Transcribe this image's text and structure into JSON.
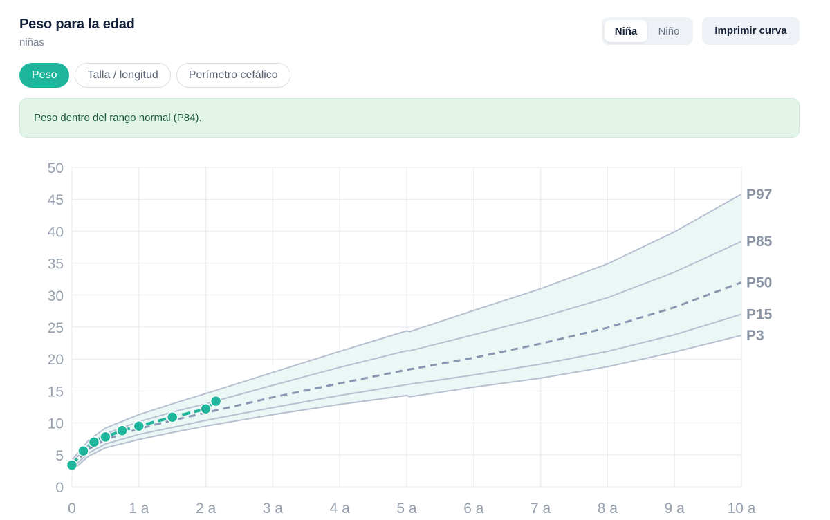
{
  "header": {
    "title": "Peso para la edad",
    "subtitle": "niñas",
    "sex_options": [
      "Niña",
      "Niño"
    ],
    "sex_selected": "Niña",
    "print_label": "Imprimir curva"
  },
  "tabs": [
    {
      "label": "Peso",
      "active": true
    },
    {
      "label": "Talla / longitud",
      "active": false
    },
    {
      "label": "Perímetro cefálico",
      "active": false
    }
  ],
  "status": {
    "message": "Peso dentro del rango normal (P84).",
    "color": "#e3f5e8"
  },
  "colors": {
    "accent": "#1db59b",
    "curve": "#b7c0d0",
    "median": "#8a97b3",
    "band": "#eaf7f5"
  },
  "chart_data": {
    "type": "line",
    "title": "",
    "xlabel": "",
    "ylabel": "",
    "xlim": [
      0,
      10
    ],
    "ylim": [
      0,
      50
    ],
    "x_ticks": [
      0,
      1,
      2,
      3,
      4,
      5,
      6,
      7,
      8,
      9,
      10
    ],
    "x_tick_labels": [
      "0",
      "1 a",
      "2 a",
      "3 a",
      "4 a",
      "5 a",
      "6 a",
      "7 a",
      "8 a",
      "9 a",
      "10 a"
    ],
    "y_ticks": [
      0,
      5,
      10,
      15,
      20,
      25,
      30,
      35,
      40,
      45,
      50
    ],
    "y_tick_labels": [
      "0",
      "5",
      "10",
      "15",
      "20",
      "25",
      "30",
      "35",
      "40",
      "45",
      "50"
    ],
    "grid": true,
    "shaded_band": [
      "P3",
      "P97"
    ],
    "series": [
      {
        "name": "P97",
        "style": "solid",
        "x": [
          0,
          0.25,
          0.5,
          1,
          1.5,
          2,
          3,
          4,
          5,
          5.05,
          6,
          7,
          8,
          9,
          10
        ],
        "y": [
          4.2,
          7.3,
          9.2,
          11.3,
          13.0,
          14.6,
          17.9,
          21.2,
          24.4,
          24.3,
          27.6,
          31.0,
          34.9,
          39.9,
          45.8
        ]
      },
      {
        "name": "P85",
        "style": "solid",
        "x": [
          0,
          0.25,
          0.5,
          1,
          1.5,
          2,
          3,
          4,
          5,
          5.05,
          6,
          7,
          8,
          9,
          10
        ],
        "y": [
          3.8,
          6.6,
          8.3,
          10.2,
          11.7,
          13.0,
          15.9,
          18.7,
          21.3,
          21.3,
          23.8,
          26.5,
          29.6,
          33.6,
          38.4
        ]
      },
      {
        "name": "P50",
        "style": "dashed",
        "x": [
          0,
          0.25,
          0.5,
          1,
          1.5,
          2,
          3,
          4,
          5,
          6,
          7,
          8,
          9,
          10
        ],
        "y": [
          3.3,
          5.9,
          7.4,
          9.1,
          10.4,
          11.6,
          14.0,
          16.2,
          18.3,
          20.2,
          22.4,
          24.9,
          28.1,
          32.0
        ]
      },
      {
        "name": "P15",
        "style": "solid",
        "x": [
          0,
          0.25,
          0.5,
          1,
          1.5,
          2,
          3,
          4,
          5,
          6,
          7,
          8,
          9,
          10
        ],
        "y": [
          2.9,
          5.3,
          6.7,
          8.2,
          9.3,
          10.4,
          12.4,
          14.3,
          16.0,
          17.5,
          19.2,
          21.2,
          23.8,
          27.0
        ]
      },
      {
        "name": "P3",
        "style": "solid",
        "x": [
          0,
          0.25,
          0.5,
          1,
          1.5,
          2,
          3,
          4,
          5,
          5.05,
          6,
          7,
          8,
          9,
          10
        ],
        "y": [
          2.5,
          4.8,
          6.1,
          7.4,
          8.5,
          9.5,
          11.3,
          12.9,
          14.3,
          14.1,
          15.6,
          17.0,
          18.8,
          21.1,
          23.7
        ]
      },
      {
        "name": "",
        "style": "patient",
        "x": [
          0,
          0.17,
          0.33,
          0.5,
          0.75,
          1.0,
          1.5,
          2.0,
          2.15
        ],
        "y": [
          3.4,
          5.6,
          7.0,
          7.8,
          8.8,
          9.5,
          10.9,
          12.2,
          13.4
        ]
      }
    ]
  }
}
